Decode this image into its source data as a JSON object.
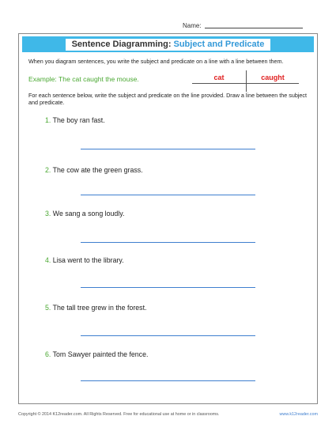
{
  "header": {
    "name_label": "Name:"
  },
  "title": {
    "part1": "Sentence Diagramming:",
    "part2": "Subject and Predicate"
  },
  "intro": "When you diagram sentences, you write the subject and predicate on a line with a line between them.",
  "example": {
    "text": "Example: The cat caught the mouse.",
    "subject": "cat",
    "predicate": "caught"
  },
  "instructions": "For each sentence below, write the subject and predicate on the line provided. Draw a line between the subject and predicate.",
  "sentences": [
    {
      "num": "1.",
      "text": "The boy ran fast."
    },
    {
      "num": "2.",
      "text": "The cow ate the green grass."
    },
    {
      "num": "3.",
      "text": "We sang a song loudly."
    },
    {
      "num": "4.",
      "text": "Lisa went to the library."
    },
    {
      "num": "5.",
      "text": "The tall tree grew in the forest."
    },
    {
      "num": "6.",
      "text": "Tom Sawyer painted the fence."
    }
  ],
  "footer": {
    "copyright": "Copyright © 2014  K12reader.com. All Rights Reserved. Free for educational use at home or in classrooms.",
    "site": "www.k12reader.com"
  },
  "colors": {
    "title_bar": "#3fb8e8",
    "accent_green": "#4aa832",
    "diagram_red": "#e02020",
    "answer_line": "#3f7fcf"
  }
}
